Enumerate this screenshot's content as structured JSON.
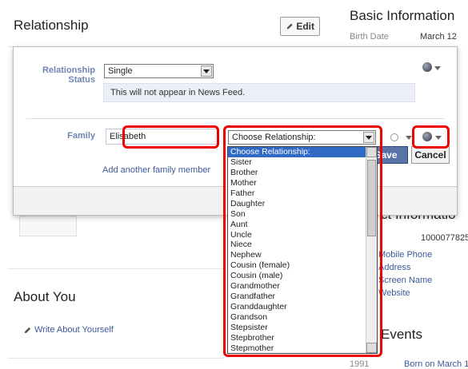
{
  "page": {
    "relationship_title": "Relationship",
    "edit_label": "Edit",
    "basic_info_title": "Basic Information",
    "birth_date_label": "Birth Date",
    "birth_date_value": "March 12",
    "about_you_title": "About You",
    "write_about_link": "Write About Yourself",
    "contact_info_partial": "ct Informatio",
    "user_id_partial": "1000077825",
    "contact_fields": [
      "Mobile Phone",
      "Address",
      "Screen Name",
      "Website"
    ],
    "events_partial": "Events",
    "year_partial": "1991",
    "born_partial": "Born on March 1"
  },
  "modal": {
    "relationship_status_label": "Relationship Status",
    "status_value": "Single",
    "status_note": "This will not appear in News Feed.",
    "family_label": "Family",
    "family_name_value": "Elisabeth",
    "choose_relationship_value": "Choose Relationship:",
    "add_family_link": "Add another family member",
    "save_label": "Save",
    "cancel_label": "Cancel"
  },
  "dropdown": {
    "options": [
      "Choose Relationship:",
      "Sister",
      "Brother",
      "Mother",
      "Father",
      "Daughter",
      "Son",
      "Aunt",
      "Uncle",
      "Niece",
      "Nephew",
      "Cousin (female)",
      "Cousin (male)",
      "Grandmother",
      "Grandfather",
      "Granddaughter",
      "Grandson",
      "Stepsister",
      "Stepbrother",
      "Stepmother"
    ],
    "selected_index": 0
  },
  "colors": {
    "link": "#3b5998",
    "label": "#6d84b4",
    "highlight": "#e00000",
    "save_button": "#5b74a8"
  }
}
